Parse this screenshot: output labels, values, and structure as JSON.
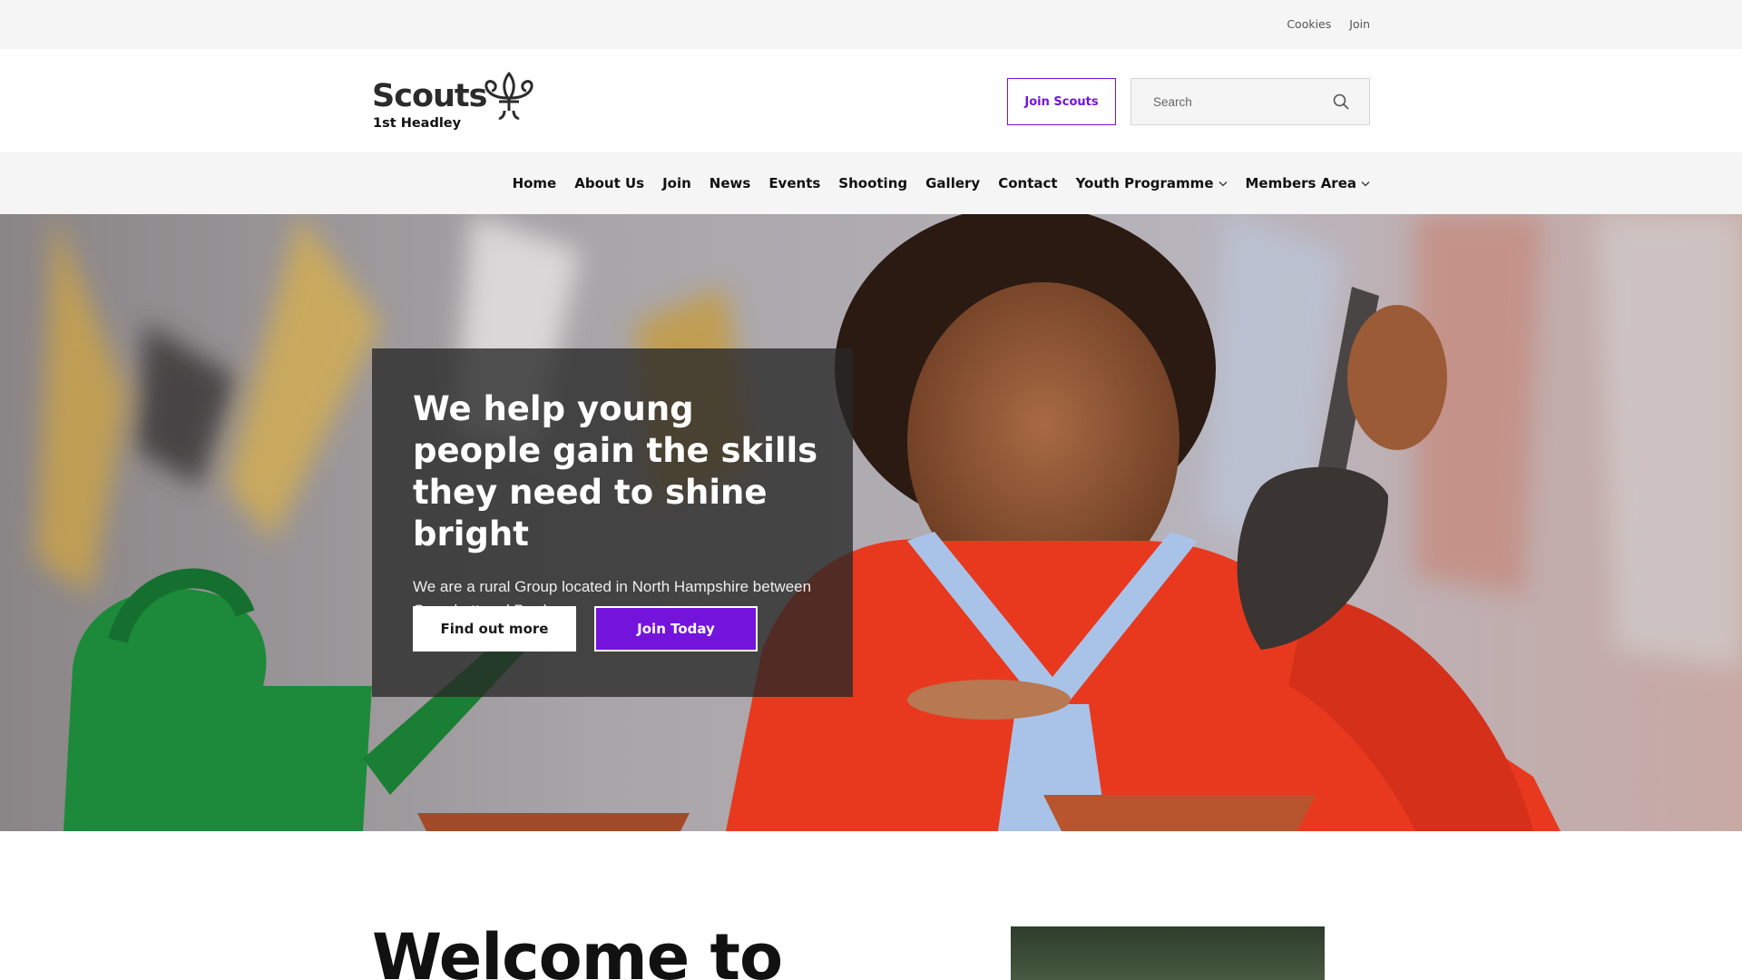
{
  "utility": {
    "links": [
      "Cookies",
      "Join"
    ]
  },
  "header": {
    "logo_word": "Scouts",
    "logo_group": "1st Headley",
    "join_button": "Join Scouts",
    "search_placeholder": "Search"
  },
  "nav": {
    "items": [
      {
        "label": "Home"
      },
      {
        "label": "About Us"
      },
      {
        "label": "Join"
      },
      {
        "label": "News"
      },
      {
        "label": "Events"
      },
      {
        "label": "Shooting"
      },
      {
        "label": "Gallery"
      },
      {
        "label": "Contact"
      },
      {
        "label": "Youth Programme",
        "dropdown": true
      },
      {
        "label": "Members Area",
        "dropdown": true
      }
    ]
  },
  "hero": {
    "title": "We help young people gain the skills they need to shine bright",
    "subtitle": "We are a rural Group located in North Hampshire between Grayshott and Bordon.",
    "button_primary": "Find out more",
    "button_secondary": "Join Today"
  },
  "welcome": {
    "heading": "Welcome to"
  },
  "colors": {
    "brand_purple": "#7413dc",
    "utility_bg": "#f5f5f5",
    "hero_card_bg": "#282828"
  }
}
